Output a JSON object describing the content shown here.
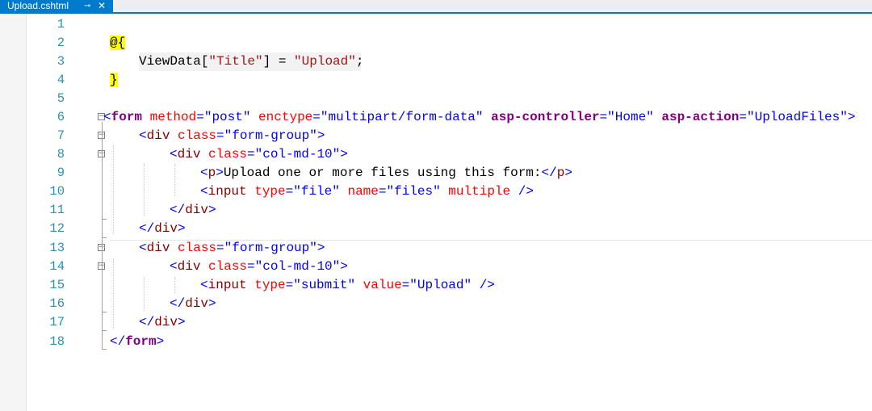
{
  "tab": {
    "title": "Upload.cshtml",
    "pin_icon": "pin-icon",
    "close_icon": "close-icon"
  },
  "colors": {
    "accent": "#007acc",
    "line_number": "#2b91af",
    "razor_highlight": "#ffff00"
  },
  "line_numbers": [
    "1",
    "2",
    "3",
    "4",
    "5",
    "6",
    "7",
    "8",
    "9",
    "10",
    "11",
    "12",
    "13",
    "14",
    "15",
    "16",
    "17",
    "18"
  ],
  "lines": {
    "l2": {
      "open": "@{"
    },
    "l3": {
      "text": "ViewData[",
      "str": "\"Title\"",
      "rest": "] = ",
      "str2": "\"Upload\"",
      "end": ";"
    },
    "l4": {
      "close": "}"
    },
    "l6": {
      "lt": "<",
      "tag": "form",
      "a1": " method",
      "eq1": "=",
      "v1": "\"post\"",
      "a2": " enctype",
      "eq2": "=",
      "v2": "\"multipart/form-data\"",
      "a3": " asp-controller",
      "eq3": "=",
      "v3": "\"Home\"",
      "a4": " asp-action",
      "eq4": "=",
      "v4": "\"UploadFiles\"",
      "gt": ">"
    },
    "l7": {
      "lt": "<",
      "tag": "div",
      "a1": " class",
      "eq1": "=",
      "v1": "\"form-group\"",
      "gt": ">"
    },
    "l8": {
      "lt": "<",
      "tag": "div",
      "a1": " class",
      "eq1": "=",
      "v1": "\"col-md-10\"",
      "gt": ">"
    },
    "l9": {
      "lt": "<",
      "tag": "p",
      "gt": ">",
      "text": "Upload one or more files using this form:",
      "lt2": "</",
      "tag2": "p",
      "gt2": ">"
    },
    "l10": {
      "lt": "<",
      "tag": "input",
      "a1": " type",
      "eq1": "=",
      "v1": "\"file\"",
      "a2": " name",
      "eq2": "=",
      "v2": "\"files\"",
      "a3": " multiple",
      "gt": " />"
    },
    "l11": {
      "lt": "</",
      "tag": "div",
      "gt": ">"
    },
    "l12": {
      "lt": "</",
      "tag": "div",
      "gt": ">"
    },
    "l13": {
      "lt": "<",
      "tag": "div",
      "a1": " class",
      "eq1": "=",
      "v1": "\"form-group\"",
      "gt": ">"
    },
    "l14": {
      "lt": "<",
      "tag": "div",
      "a1": " class",
      "eq1": "=",
      "v1": "\"col-md-10\"",
      "gt": ">"
    },
    "l15": {
      "lt": "<",
      "tag": "input",
      "a1": " type",
      "eq1": "=",
      "v1": "\"submit\"",
      "a2": " value",
      "eq2": "=",
      "v2": "\"Upload\"",
      "gt": " />"
    },
    "l16": {
      "lt": "</",
      "tag": "div",
      "gt": ">"
    },
    "l17": {
      "lt": "</",
      "tag": "div",
      "gt": ">"
    },
    "l18": {
      "lt": "</",
      "tag": "form",
      "gt": ">"
    }
  }
}
